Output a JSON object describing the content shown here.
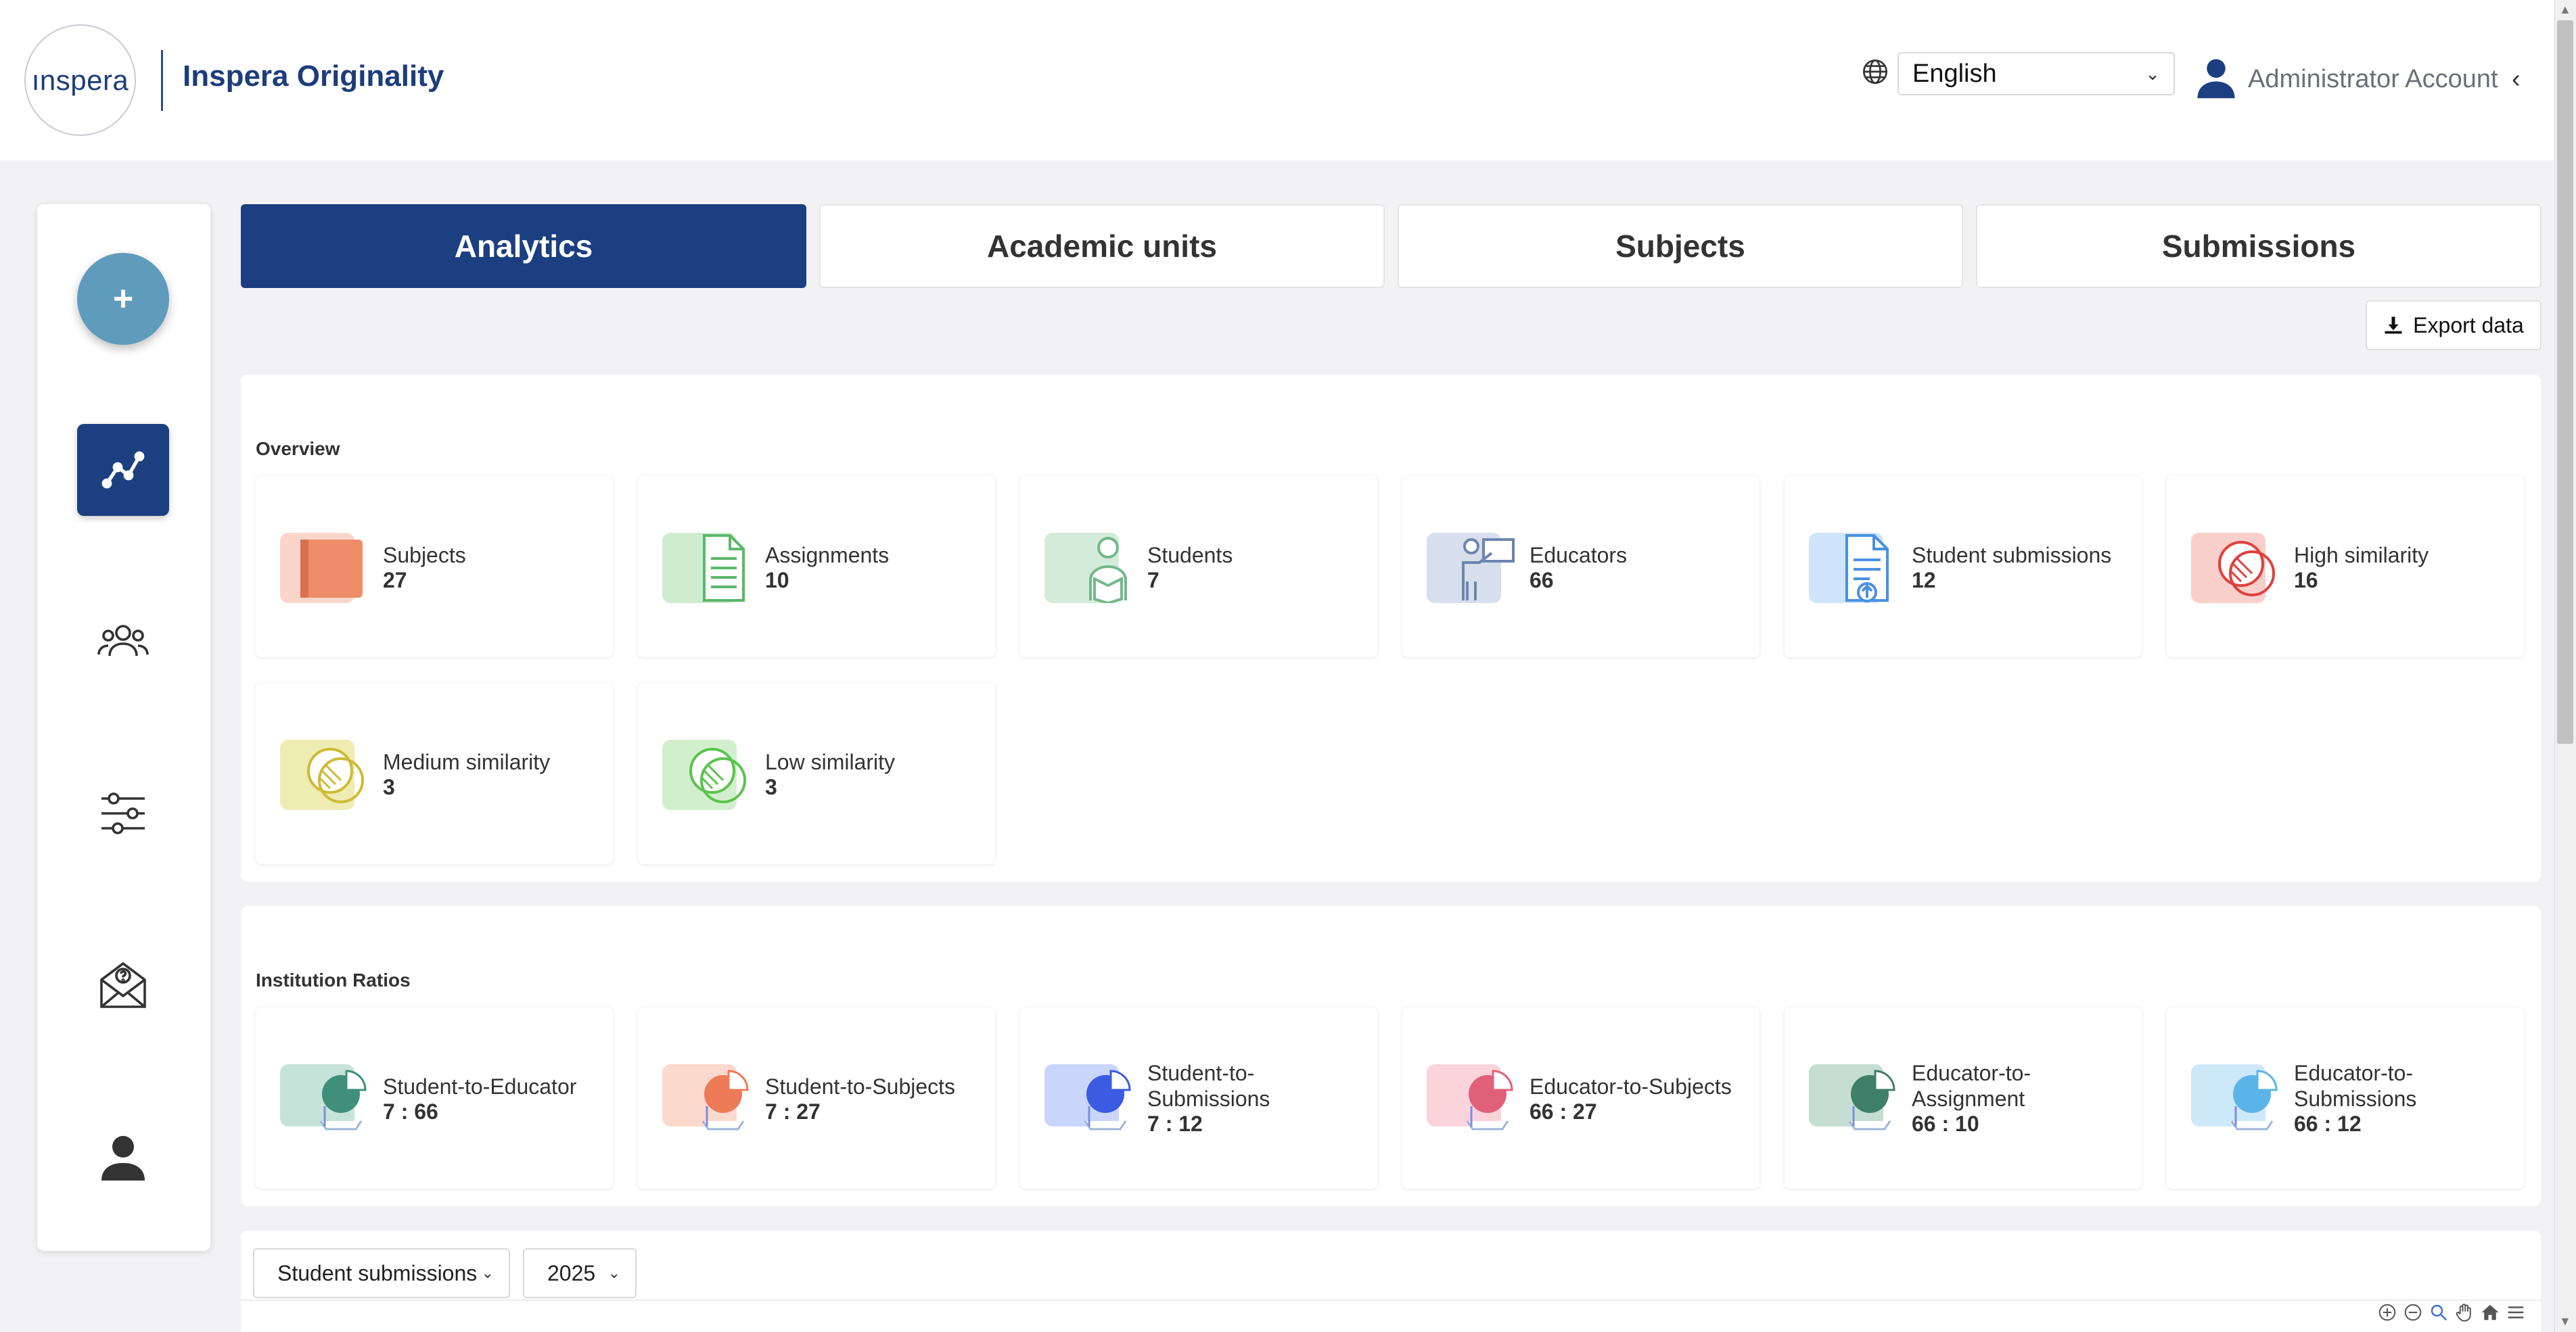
{
  "header": {
    "logo_text": "ınspera",
    "product_name": "Inspera Originality",
    "language": "English",
    "account_name": "Administrator Account"
  },
  "sidebar": {
    "add_label": "+",
    "items": [
      {
        "name": "analytics",
        "icon": "analytics-icon",
        "active": true
      },
      {
        "name": "users",
        "icon": "users-icon",
        "active": false
      },
      {
        "name": "settings",
        "icon": "sliders-icon",
        "active": false
      },
      {
        "name": "support",
        "icon": "mail-question-icon",
        "active": false
      },
      {
        "name": "profile",
        "icon": "user-icon",
        "active": false
      }
    ]
  },
  "tabs": [
    {
      "label": "Analytics",
      "active": true
    },
    {
      "label": "Academic units",
      "active": false
    },
    {
      "label": "Subjects",
      "active": false
    },
    {
      "label": "Submissions",
      "active": false
    }
  ],
  "export_label": "Export data",
  "overview": {
    "title": "Overview",
    "cards": [
      {
        "label": "Subjects",
        "value": "27",
        "icon": "book-icon",
        "color": "#ee8b68"
      },
      {
        "label": "Assignments",
        "value": "10",
        "icon": "document-icon",
        "color": "#5bb86a"
      },
      {
        "label": "Students",
        "value": "7",
        "icon": "student-icon",
        "color": "#72b88a"
      },
      {
        "label": "Educators",
        "value": "66",
        "icon": "educator-icon",
        "color": "#6b86ad"
      },
      {
        "label": "Student submissions",
        "value": "12",
        "icon": "submission-icon",
        "color": "#4a90e2"
      },
      {
        "label": "High similarity",
        "value": "16",
        "icon": "high-similarity-icon",
        "color": "#e0403c"
      },
      {
        "label": "Medium similarity",
        "value": "3",
        "icon": "medium-similarity-icon",
        "color": "#cdbb35"
      },
      {
        "label": "Low similarity",
        "value": "3",
        "icon": "low-similarity-icon",
        "color": "#5cc24e"
      }
    ]
  },
  "ratios": {
    "title": "Institution Ratios",
    "cards": [
      {
        "label": "Student-to-Educator",
        "value": "7 : 66",
        "icon": "pie-chart-icon",
        "color": "#3f8f7a"
      },
      {
        "label": "Student-to-Subjects",
        "value": "7 : 27",
        "icon": "pie-chart-icon",
        "color": "#ee7b58"
      },
      {
        "label": "Student-to-Submissions",
        "value": "7 : 12",
        "icon": "pie-chart-icon",
        "color": "#3b5be0"
      },
      {
        "label": "Educator-to-Subjects",
        "value": "66 : 27",
        "icon": "pie-chart-icon",
        "color": "#e0607a"
      },
      {
        "label": "Educator-to-Assignment",
        "value": "66 : 10",
        "icon": "pie-chart-icon",
        "color": "#3f7f6a"
      },
      {
        "label": "Educator-to-Submissions",
        "value": "66 : 12",
        "icon": "pie-chart-icon",
        "color": "#5ab4e8"
      }
    ]
  },
  "filters": {
    "metric": "Student submissions",
    "year": "2025"
  }
}
